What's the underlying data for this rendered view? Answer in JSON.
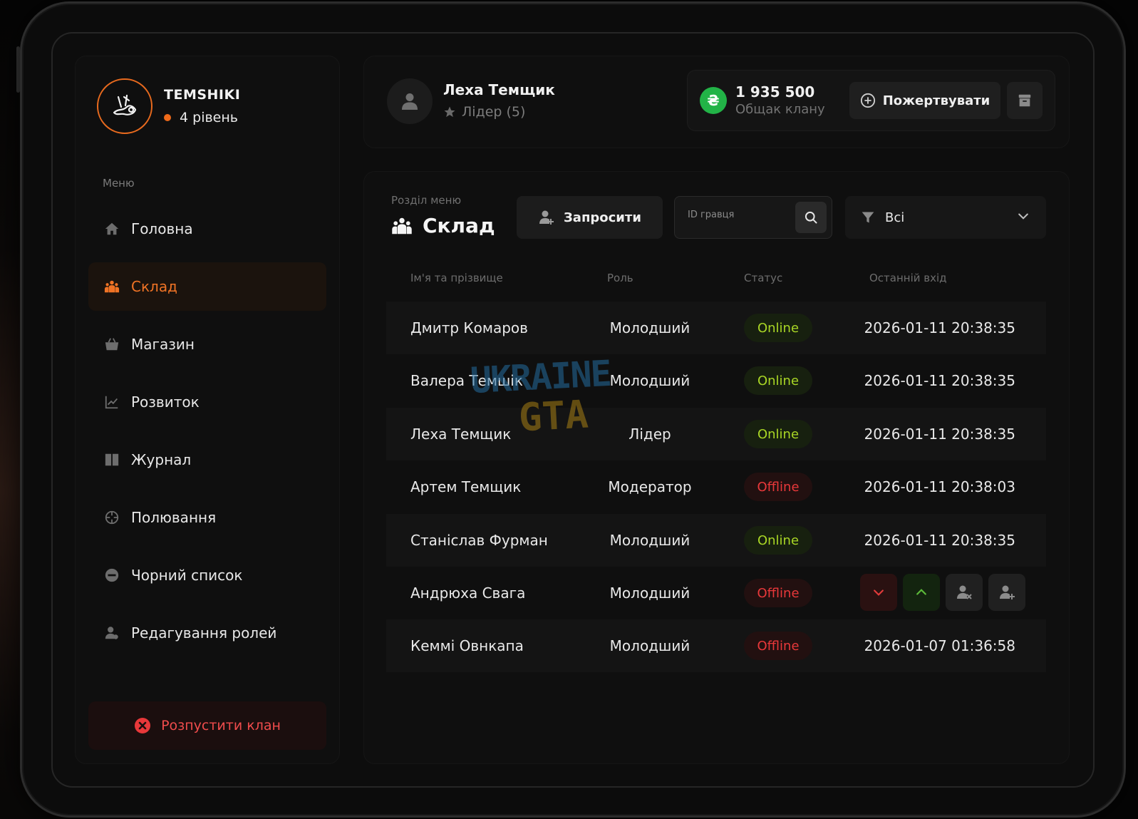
{
  "clan": {
    "name": "TEMSHIKI",
    "level": "4 рівень"
  },
  "menu": {
    "caption": "Меню",
    "items": [
      {
        "label": "Головна",
        "icon": "home-icon"
      },
      {
        "label": "Склад",
        "icon": "people-icon",
        "active": true
      },
      {
        "label": "Магазин",
        "icon": "basket-icon"
      },
      {
        "label": "Розвиток",
        "icon": "chart-icon"
      },
      {
        "label": "Журнал",
        "icon": "book-icon"
      },
      {
        "label": "Полювання",
        "icon": "crosshair-icon"
      },
      {
        "label": "Чорний список",
        "icon": "block-icon"
      },
      {
        "label": "Редагування ролей",
        "icon": "user-icon"
      }
    ],
    "disband_label": "Розпустити клан"
  },
  "user": {
    "name": "Леха Темщик",
    "role": "Лідер (5)"
  },
  "bank": {
    "currency_symbol": "₴",
    "amount": "1 935 500",
    "caption": "Общак клану",
    "donate_label": "Пожертвувати"
  },
  "section": {
    "caption": "Розділ меню",
    "title": "Склад",
    "invite_label": "Запросити",
    "search_placeholder": "ID гравця",
    "filter_value": "Всі"
  },
  "table": {
    "headers": {
      "name": "Ім'я та прізвище",
      "role": "Роль",
      "status": "Статус",
      "last_login": "Останній вхід"
    },
    "rows": [
      {
        "name": "Дмитр Комаров",
        "role": "Молодший",
        "status": "Online",
        "last_login": "2026-01-11 20:38:35"
      },
      {
        "name": "Валера Темшік",
        "role": "Молодший",
        "status": "Online",
        "last_login": "2026-01-11 20:38:35"
      },
      {
        "name": "Леха Темщик",
        "role": "Лідер",
        "status": "Online",
        "last_login": "2026-01-11 20:38:35"
      },
      {
        "name": "Артем Темщик",
        "role": "Модератор",
        "status": "Offline",
        "last_login": "2026-01-11 20:38:03"
      },
      {
        "name": "Станіслав Фурман",
        "role": "Молодший",
        "status": "Online",
        "last_login": "2026-01-11 20:38:35"
      },
      {
        "name": "Андрюха Свага",
        "role": "Молодший",
        "status": "Offline",
        "last_login": ""
      },
      {
        "name": "Кеммі Овнкапа",
        "role": "Молодший",
        "status": "Offline",
        "last_login": "2026-01-07 01:36:58"
      }
    ]
  },
  "watermark": {
    "line1": "UKRAINE",
    "line2": "GTA"
  },
  "colors": {
    "accent": "#ef7325",
    "online": "#a9d625",
    "offline": "#e8383a",
    "coin": "#22b347"
  }
}
